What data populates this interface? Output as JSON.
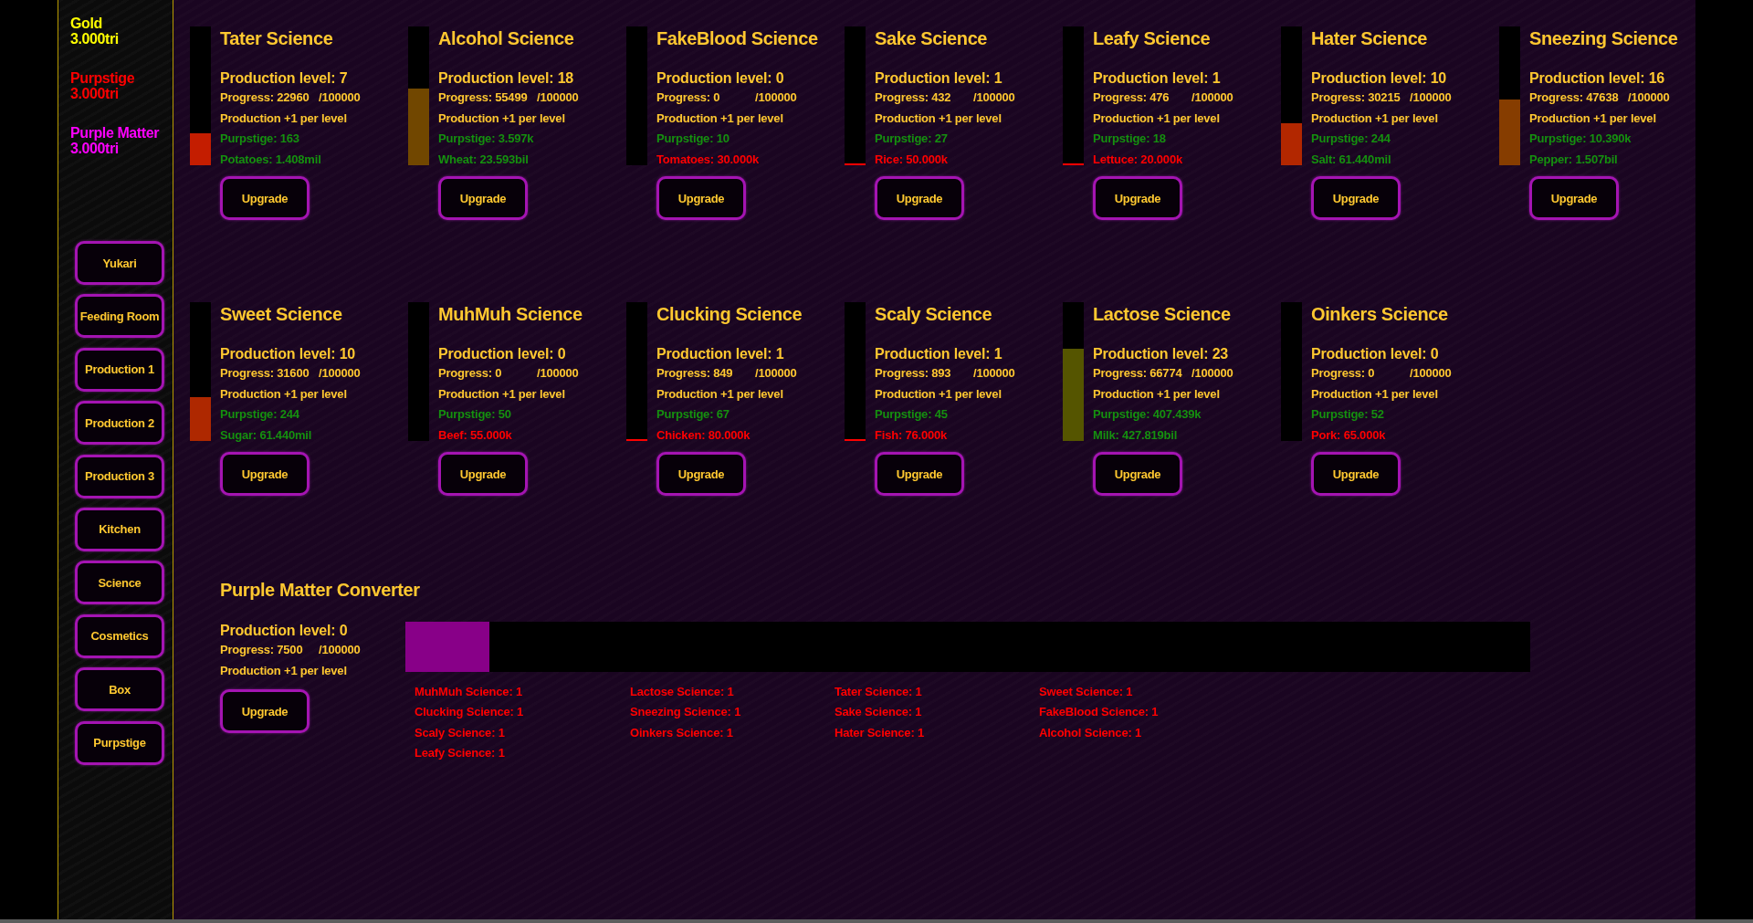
{
  "stats": [
    {
      "label": "Gold",
      "value": "3.000tri",
      "color": "#ffff00"
    },
    {
      "label": "Purpstige",
      "value": "3.000tri",
      "color": "#ff0000"
    },
    {
      "label": "Purple Matter",
      "value": "3.000tri",
      "color": "#ff00ff"
    }
  ],
  "nav": [
    {
      "label": "Yukari"
    },
    {
      "label": "Feeding Room"
    },
    {
      "label": "Production 1"
    },
    {
      "label": "Production 2"
    },
    {
      "label": "Production 3"
    },
    {
      "label": "Kitchen"
    },
    {
      "label": "Science"
    },
    {
      "label": "Cosmetics"
    },
    {
      "label": "Box"
    },
    {
      "label": "Purpstige"
    }
  ],
  "sciences": [
    {
      "title": "Tater Science",
      "production_level": "Production level: 7",
      "progress": "Progress: 22960",
      "progress_max": "/100000",
      "level": 0.2296,
      "bonus": "Production +1 per level",
      "purpstige": "Purpstige: 163",
      "cost": {
        "text": "Potatoes: 1.408mil",
        "affordable": true
      },
      "upgrade": "Upgrade"
    },
    {
      "title": "Alcohol Science",
      "production_level": "Production level: 18",
      "progress": "Progress: 55499",
      "progress_max": "/100000",
      "level": 0.55499,
      "bonus": "Production +1 per level",
      "purpstige": "Purpstige: 3.597k",
      "cost": {
        "text": "Wheat: 23.593bil",
        "affordable": true
      },
      "upgrade": "Upgrade"
    },
    {
      "title": "FakeBlood Science",
      "production_level": "Production level: 0",
      "progress": "Progress: 0",
      "progress_max": "/100000",
      "level": 0,
      "bonus": "Production +1 per level",
      "purpstige": "Purpstige: 10",
      "cost": {
        "text": "Tomatoes: 30.000k",
        "affordable": false
      },
      "upgrade": "Upgrade"
    },
    {
      "title": "Sake Science",
      "production_level": "Production level: 1",
      "progress": "Progress: 432",
      "progress_max": "/100000",
      "level": 0.00432,
      "bonus": "Production +1 per level",
      "purpstige": "Purpstige: 27",
      "cost": {
        "text": "Rice: 50.000k",
        "affordable": false
      },
      "upgrade": "Upgrade"
    },
    {
      "title": "Leafy Science",
      "production_level": "Production level: 1",
      "progress": "Progress: 476",
      "progress_max": "/100000",
      "level": 0.00476,
      "bonus": "Production +1 per level",
      "purpstige": "Purpstige: 18",
      "cost": {
        "text": "Lettuce: 20.000k",
        "affordable": false
      },
      "upgrade": "Upgrade"
    },
    {
      "title": "Hater Science",
      "production_level": "Production level: 10",
      "progress": "Progress: 30215",
      "progress_max": "/100000",
      "level": 0.30215,
      "bonus": "Production +1 per level",
      "purpstige": "Purpstige: 244",
      "cost": {
        "text": "Salt: 61.440mil",
        "affordable": true
      },
      "upgrade": "Upgrade"
    },
    {
      "title": "Sneezing Science",
      "production_level": "Production level: 16",
      "progress": "Progress: 47638",
      "progress_max": "/100000",
      "level": 0.47638,
      "bonus": "Production +1 per level",
      "purpstige": "Purpstige: 10.390k",
      "cost": {
        "text": "Pepper: 1.507bil",
        "affordable": true
      },
      "upgrade": "Upgrade"
    },
    {
      "title": "Sweet Science",
      "production_level": "Production level: 10",
      "progress": "Progress: 31600",
      "progress_max": "/100000",
      "level": 0.316,
      "bonus": "Production +1 per level",
      "purpstige": "Purpstige: 244",
      "cost": {
        "text": "Sugar: 61.440mil",
        "affordable": true
      },
      "upgrade": "Upgrade"
    },
    {
      "title": "MuhMuh Science",
      "production_level": "Production level: 0",
      "progress": "Progress: 0",
      "progress_max": "/100000",
      "level": 0,
      "bonus": "Production +1 per level",
      "purpstige": "Purpstige: 50",
      "cost": {
        "text": "Beef: 55.000k",
        "affordable": false
      },
      "upgrade": "Upgrade"
    },
    {
      "title": "Clucking Science",
      "production_level": "Production level: 1",
      "progress": "Progress: 849",
      "progress_max": "/100000",
      "level": 0.00849,
      "bonus": "Production +1 per level",
      "purpstige": "Purpstige: 67",
      "cost": {
        "text": "Chicken: 80.000k",
        "affordable": false
      },
      "upgrade": "Upgrade"
    },
    {
      "title": "Scaly Science",
      "production_level": "Production level: 1",
      "progress": "Progress: 893",
      "progress_max": "/100000",
      "level": 0.00893,
      "bonus": "Production +1 per level",
      "purpstige": "Purpstige: 45",
      "cost": {
        "text": "Fish: 76.000k",
        "affordable": false
      },
      "upgrade": "Upgrade"
    },
    {
      "title": "Lactose Science",
      "production_level": "Production level: 23",
      "progress": "Progress: 66774",
      "progress_max": "/100000",
      "level": 0.66774,
      "bonus": "Production +1 per level",
      "purpstige": "Purpstige: 407.439k",
      "cost": {
        "text": "Milk: 427.819bil",
        "affordable": true
      },
      "upgrade": "Upgrade"
    },
    {
      "title": "Oinkers Science",
      "production_level": "Production level: 0",
      "progress": "Progress: 0",
      "progress_max": "/100000",
      "level": 0,
      "bonus": "Production +1 per level",
      "purpstige": "Purpstige: 52",
      "cost": {
        "text": "Pork: 65.000k",
        "affordable": false
      },
      "upgrade": "Upgrade"
    }
  ],
  "converter": {
    "title": "Purple Matter Converter",
    "production_level": "Production level: 0",
    "progress": "Progress: 7500",
    "progress_max": "/100000",
    "bonus": "Production +1 per level",
    "upgrade": "Upgrade",
    "level": 0.075,
    "requirements": [
      "MuhMuh Science: 1",
      "Clucking Science: 1",
      "Scaly Science: 1",
      "Leafy Science: 1",
      "Lactose Science: 1",
      "Sneezing Science: 1",
      "Oinkers Science: 1",
      "Tater Science: 1",
      "Sake Science: 1",
      "Hater Science: 1",
      "Sweet Science: 1",
      "FakeBlood Science: 1",
      "Alcohol Science: 1"
    ]
  }
}
